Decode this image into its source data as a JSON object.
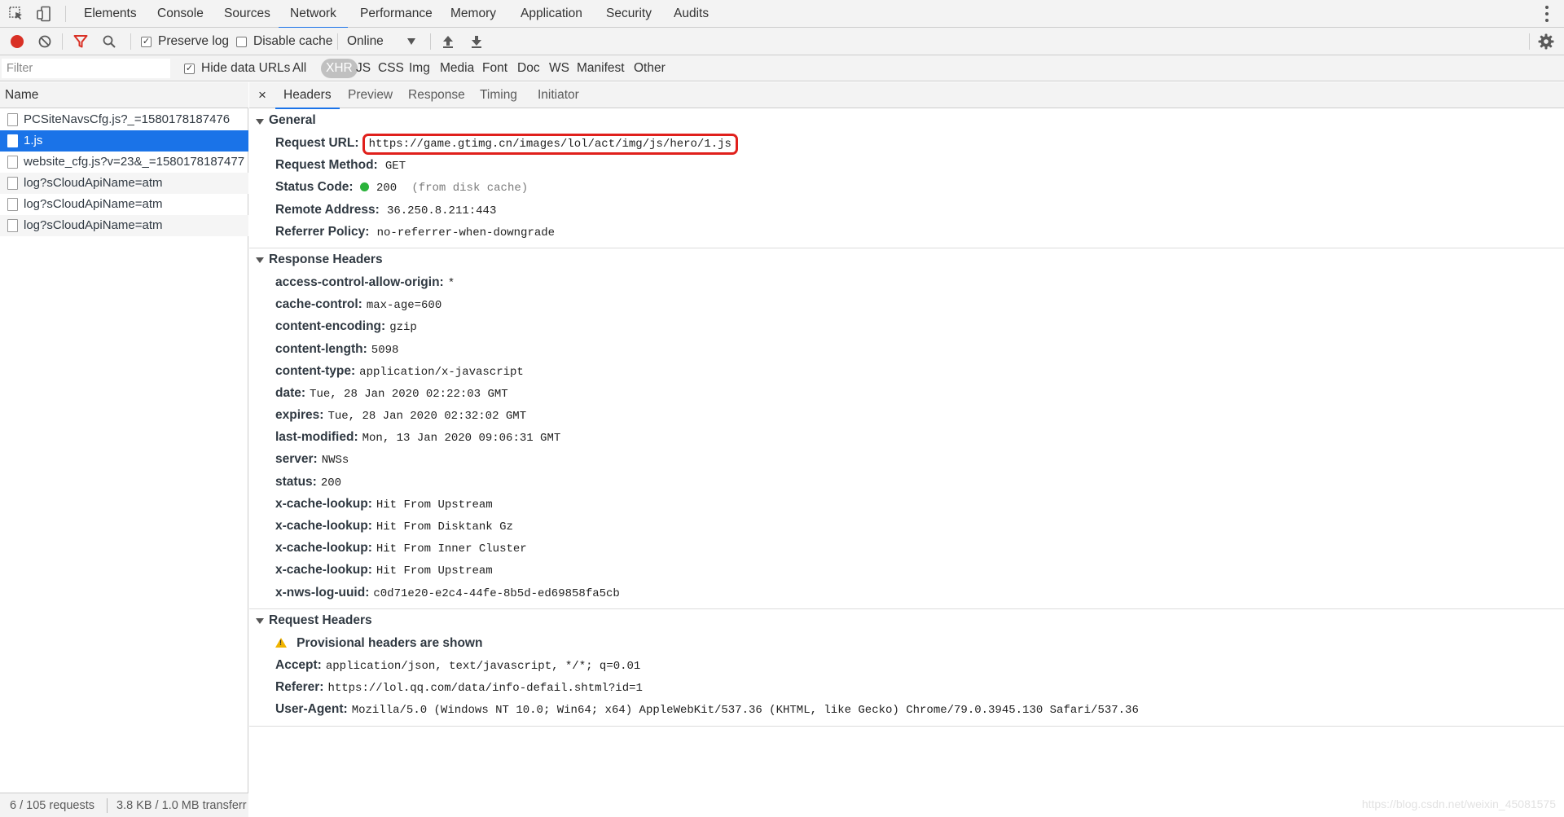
{
  "tabs": [
    "Elements",
    "Console",
    "Sources",
    "Network",
    "Performance",
    "Memory",
    "Application",
    "Security",
    "Audits"
  ],
  "active_tab": "Network",
  "toolbar": {
    "preserve_log_label": "Preserve log",
    "preserve_log_checked": true,
    "disable_cache_label": "Disable cache",
    "disable_cache_checked": false,
    "throttle_value": "Online"
  },
  "filterbar": {
    "filter_placeholder": "Filter",
    "hide_data_urls_label": "Hide data URLs",
    "hide_data_urls_checked": true,
    "types": [
      "All",
      "XHR",
      "JS",
      "CSS",
      "Img",
      "Media",
      "Font",
      "Doc",
      "WS",
      "Manifest",
      "Other"
    ],
    "active_type": "XHR"
  },
  "requests": {
    "header": "Name",
    "items": [
      "PCSiteNavsCfg.js?_=1580178187476",
      "1.js",
      "website_cfg.js?v=23&_=1580178187477",
      "log?sCloudApiName=atm",
      "log?sCloudApiName=atm",
      "log?sCloudApiName=atm"
    ],
    "selected_index": 1,
    "status_count": "6 / 105 requests",
    "status_transfer": "3.8 KB / 1.0 MB transferr"
  },
  "detail_tabs": {
    "close": "×",
    "items": [
      "Headers",
      "Preview",
      "Response",
      "Timing",
      "Initiator"
    ],
    "active": "Headers"
  },
  "general": {
    "title": "General",
    "request_url_key": "Request URL:",
    "request_url": "https://game.gtimg.cn/images/lol/act/img/js/hero/1.js",
    "method_key": "Request Method:",
    "method": "GET",
    "status_key": "Status Code:",
    "status_code": "200",
    "status_note": "(from disk cache)",
    "status_color": "#2bb33b",
    "remote_key": "Remote Address:",
    "remote": "36.250.8.211:443",
    "referrer_key": "Referrer Policy:",
    "referrer": "no-referrer-when-downgrade"
  },
  "response_headers": {
    "title": "Response Headers",
    "items": [
      {
        "k": "access-control-allow-origin:",
        "v": "*"
      },
      {
        "k": "cache-control:",
        "v": "max-age=600"
      },
      {
        "k": "content-encoding:",
        "v": "gzip"
      },
      {
        "k": "content-length:",
        "v": "5098"
      },
      {
        "k": "content-type:",
        "v": "application/x-javascript"
      },
      {
        "k": "date:",
        "v": "Tue, 28 Jan 2020 02:22:03 GMT"
      },
      {
        "k": "expires:",
        "v": "Tue, 28 Jan 2020 02:32:02 GMT"
      },
      {
        "k": "last-modified:",
        "v": "Mon, 13 Jan 2020 09:06:31 GMT"
      },
      {
        "k": "server:",
        "v": "NWSs"
      },
      {
        "k": "status:",
        "v": "200"
      },
      {
        "k": "x-cache-lookup:",
        "v": "Hit From Upstream"
      },
      {
        "k": "x-cache-lookup:",
        "v": "Hit From Disktank Gz"
      },
      {
        "k": "x-cache-lookup:",
        "v": "Hit From Inner Cluster"
      },
      {
        "k": "x-cache-lookup:",
        "v": "Hit From Upstream"
      },
      {
        "k": "x-nws-log-uuid:",
        "v": "c0d71e20-e2c4-44fe-8b5d-ed69858fa5cb"
      }
    ]
  },
  "request_headers": {
    "title": "Request Headers",
    "warning": "Provisional headers are shown",
    "items": [
      {
        "k": "Accept:",
        "v": "application/json, text/javascript, */*; q=0.01"
      },
      {
        "k": "Referer:",
        "v": "https://lol.qq.com/data/info-defail.shtml?id=1"
      },
      {
        "k": "User-Agent:",
        "v": "Mozilla/5.0 (Windows NT 10.0; Win64; x64) AppleWebKit/537.36 (KHTML, like Gecko) Chrome/79.0.3945.130 Safari/537.36"
      }
    ]
  },
  "watermark": "https://blog.csdn.net/weixin_45081575",
  "colors": {
    "accent": "#1a73e8",
    "record": "#d93025",
    "highlight_box": "#e0201c",
    "filter_icon": "#d93025"
  },
  "icons": [
    "select-element-icon",
    "device-toolbar-icon",
    "record-icon",
    "clear-icon",
    "filter-icon",
    "search-icon",
    "upload-icon",
    "download-icon",
    "settings-gear-icon",
    "more-menu-icon",
    "warning-icon",
    "file-icon",
    "status-dot-icon"
  ]
}
